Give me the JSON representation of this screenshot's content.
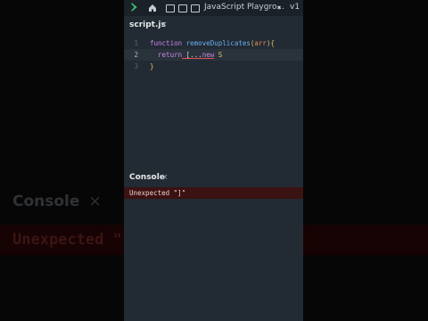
{
  "toolbar": {
    "title": "JavaScript Playgro...",
    "version": "v1"
  },
  "editor": {
    "tab_label": "script.js",
    "tab_close": "×",
    "lines": [
      {
        "number": "1"
      },
      {
        "number": "2"
      },
      {
        "number": "3"
      }
    ],
    "code": {
      "l1_keyword": "function",
      "l1_name": " removeDuplicates",
      "l1_open": "(",
      "l1_param": "arr",
      "l1_close": "){",
      "l2_keyword": "  return",
      "l2_rest_a": " [...",
      "l2_new": "new",
      "l2_rest_b": " S",
      "l3": "}"
    }
  },
  "console": {
    "title": "Console",
    "close": "×",
    "error": "Unexpected \"]\""
  },
  "backdrop": {
    "console": "Console",
    "close": "×",
    "error": "Unexpected \""
  },
  "colors": {
    "panel_bg": "#222a33",
    "error_bg": "#3a1212",
    "accent_green": "#38c172"
  }
}
